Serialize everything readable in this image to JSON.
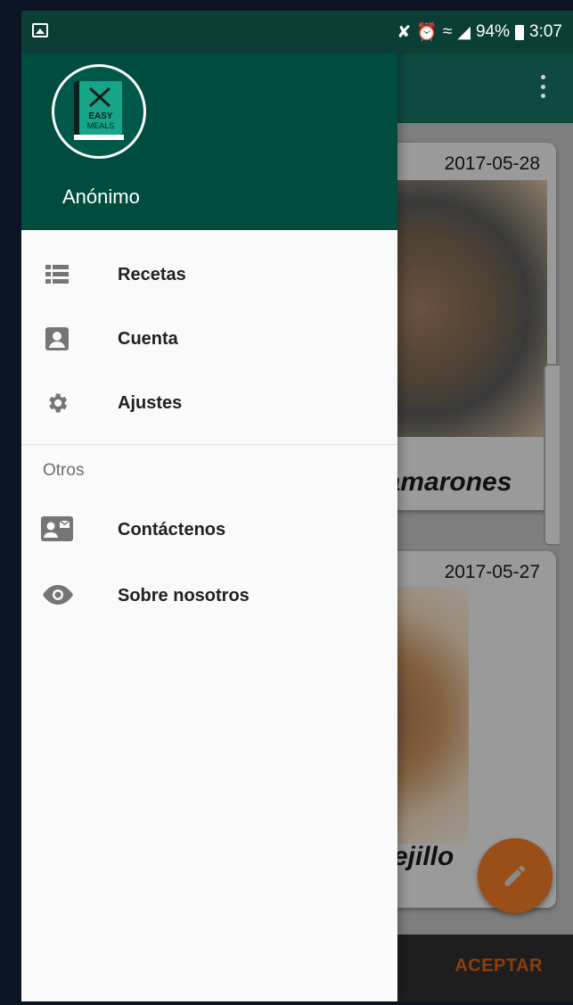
{
  "status_bar": {
    "battery": "94%",
    "time": "3:07"
  },
  "app": {
    "cards": [
      {
        "date": "2017-05-28",
        "title": "camarones"
      },
      {
        "date": "2017-05-27",
        "title": "Mejillo"
      }
    ],
    "bottom_bar": {
      "accept_label": "ACEPTAR"
    }
  },
  "drawer": {
    "logo": {
      "line1": "EASY",
      "line2": "MEALS"
    },
    "user_name": "Anónimo",
    "main_items": [
      {
        "label": "Recetas",
        "icon": "list-icon"
      },
      {
        "label": "Cuenta",
        "icon": "account-box-icon"
      },
      {
        "label": "Ajustes",
        "icon": "gear-icon"
      }
    ],
    "section_title": "Otros",
    "other_items": [
      {
        "label": "Contáctenos",
        "icon": "contact-mail-icon"
      },
      {
        "label": "Sobre nosotros",
        "icon": "eye-icon"
      }
    ]
  },
  "colors": {
    "primary_dark": "#004d40",
    "accent": "#e65100"
  }
}
